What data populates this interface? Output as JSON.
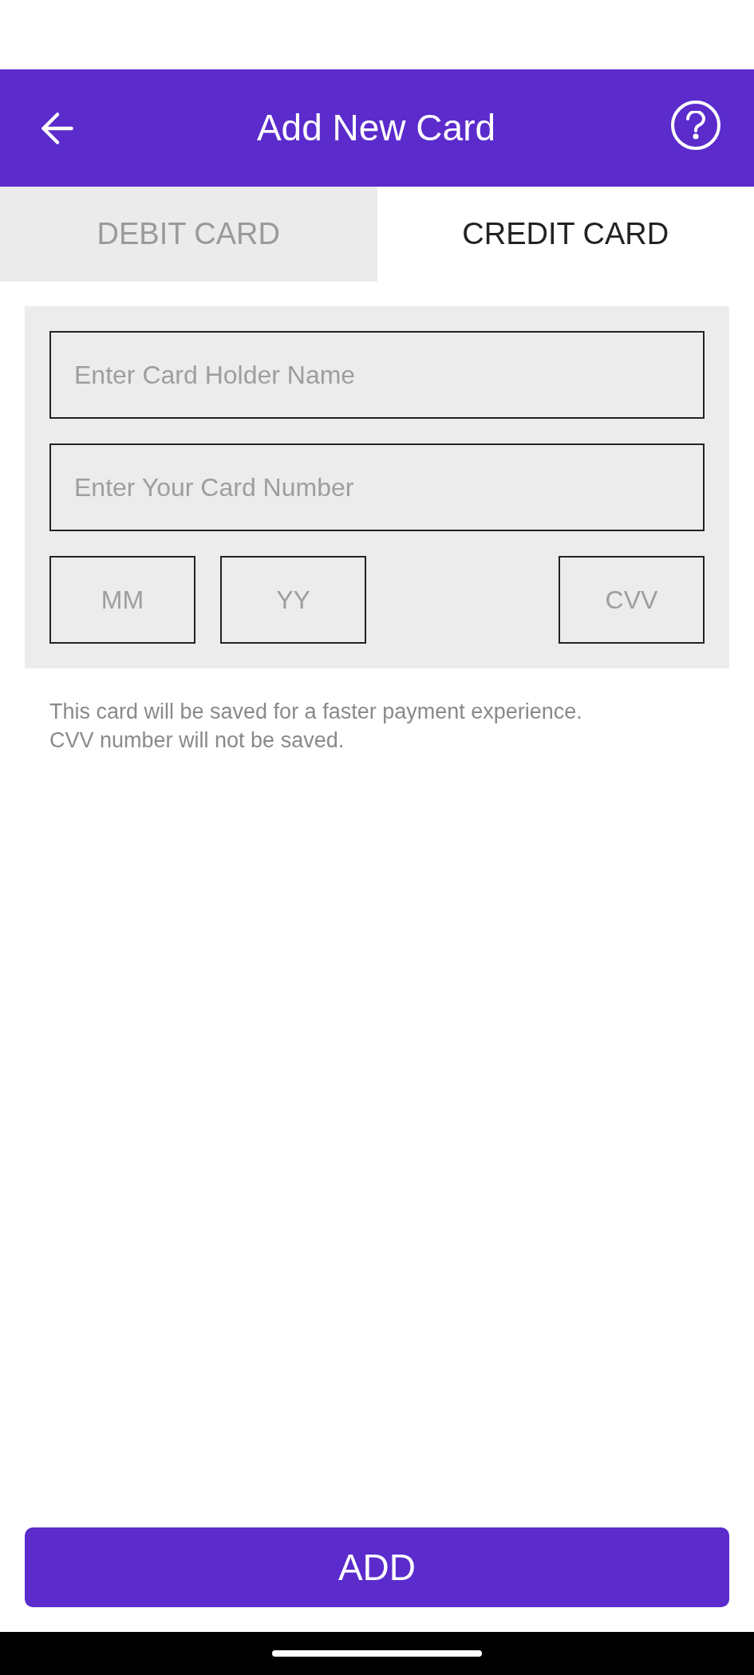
{
  "header": {
    "title": "Add New Card"
  },
  "tabs": [
    {
      "label": "DEBIT CARD",
      "selected": false
    },
    {
      "label": "CREDIT CARD",
      "selected": true
    }
  ],
  "fields": [
    {
      "placeholder": "Enter Card Holder Name"
    },
    {
      "placeholder": "Enter Your Card Number"
    }
  ],
  "expiry_fields": [
    {
      "placeholder": "MM"
    },
    {
      "placeholder": "YY"
    }
  ],
  "cvv_field": {
    "placeholder": "CVV"
  },
  "note": "This card will be saved for a faster payment experience.\nCVV number will not be saved.",
  "add_button": "ADD"
}
